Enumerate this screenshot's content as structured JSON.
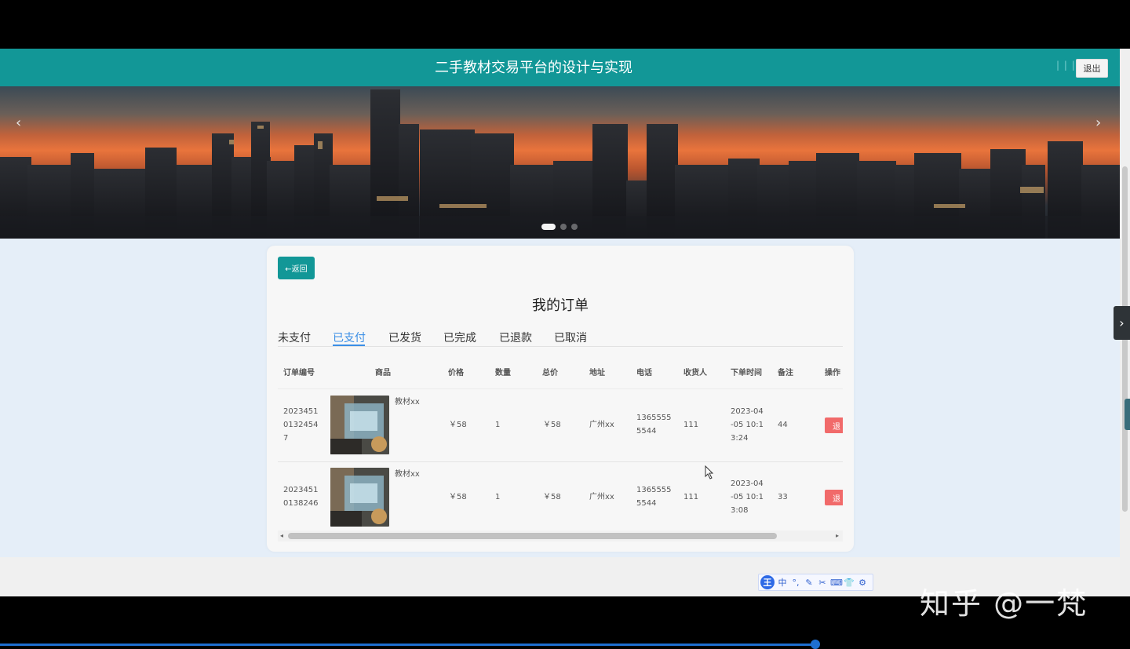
{
  "header": {
    "title": "二手教材交易平台的设计与实现",
    "dots": "| | |",
    "logout_label": "退出"
  },
  "banner": {
    "prev_label": "‹",
    "next_label": "›",
    "slide_count": 3,
    "active_slide": 1
  },
  "order_page": {
    "back_label": "←返回",
    "title": "我的订单",
    "tabs": [
      {
        "label": "未支付"
      },
      {
        "label": "已支付"
      },
      {
        "label": "已发货"
      },
      {
        "label": "已完成"
      },
      {
        "label": "已退款"
      },
      {
        "label": "已取消"
      }
    ],
    "active_tab": "已支付",
    "columns": {
      "order_no": "订单编号",
      "product": "商品",
      "price": "价格",
      "qty": "数量",
      "total": "总价",
      "address": "地址",
      "phone": "电话",
      "receiver": "收货人",
      "order_time": "下单时间",
      "remark": "备注",
      "action": "操作"
    },
    "rows": [
      {
        "order_no_lines": [
          "2023451",
          "0132454",
          "7"
        ],
        "product_name": "教材xx",
        "price": "￥58",
        "qty": "1",
        "total": "￥58",
        "address": "广州xx",
        "phone_lines": [
          "1365555",
          "5544"
        ],
        "receiver": "111",
        "time_lines": [
          "2023-04",
          "-05 10:1",
          "3:24"
        ],
        "remark": "44",
        "action_label": "退"
      },
      {
        "order_no_lines": [
          "2023451",
          "0138246"
        ],
        "product_name": "教材xx",
        "price": "￥58",
        "qty": "1",
        "total": "￥58",
        "address": "广州xx",
        "phone_lines": [
          "1365555",
          "5544"
        ],
        "receiver": "111",
        "time_lines": [
          "2023-04",
          "-05 10:1",
          "3:08"
        ],
        "remark": "33",
        "action_label": "退"
      }
    ],
    "scroll_left_arrow": "◂",
    "scroll_right_arrow": "▸"
  },
  "ime_toolbar": {
    "logo": "王",
    "items": [
      "中",
      "°,",
      "✎",
      "✂",
      "⌨",
      "👕",
      "⚙"
    ]
  },
  "watermark": "知乎 @一梵",
  "side_handle_label": "›",
  "colors": {
    "header": "#129797",
    "accent_tab": "#3a8ee6",
    "danger": "#f16a6a",
    "page_bg": "#e5eef8"
  }
}
